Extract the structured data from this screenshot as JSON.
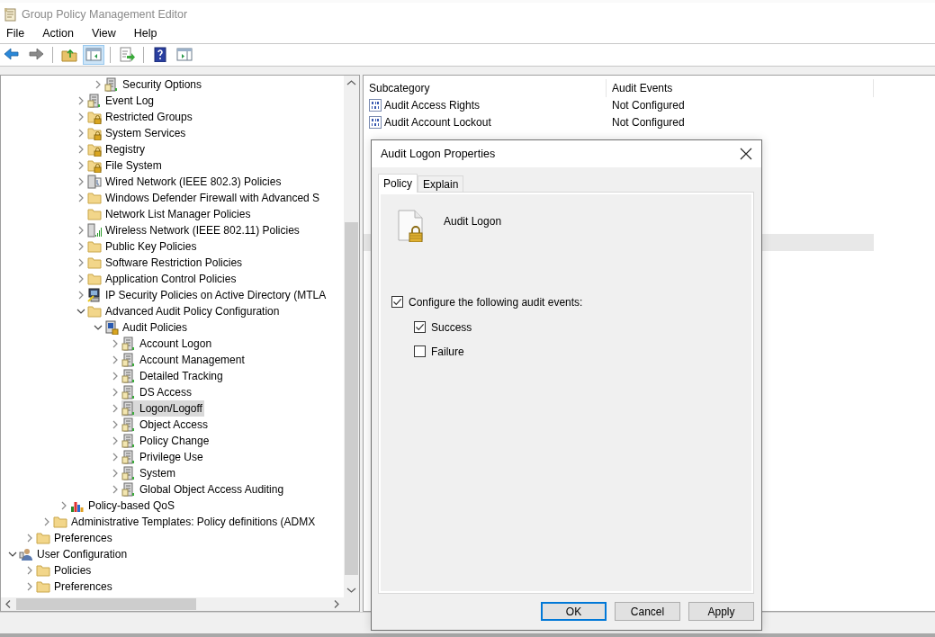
{
  "window": {
    "title": "Group Policy Management Editor"
  },
  "menu": [
    "File",
    "Action",
    "View",
    "Help"
  ],
  "toolbar": {
    "buttons": [
      {
        "pressed": false
      },
      {
        "pressed": false
      },
      {
        "pressed": false
      },
      {
        "pressed": true
      },
      {
        "pressed": false
      },
      {
        "pressed": false
      },
      {
        "pressed": false
      }
    ]
  },
  "tree": {
    "items": [
      {
        "children": [
          {
            "children": [
              {
                "children": [
                  {
                    "children": [
                      {
                        "children": [
                          {
                            "label": "Security Options",
                            "kind": "policy",
                            "expanded": false,
                            "selected": false
                          }
                        ]
                      },
                      {
                        "label": "Event Log",
                        "kind": "policy",
                        "expanded": false,
                        "selected": false
                      },
                      {
                        "label": "Restricted Groups",
                        "kind": "lockfolder",
                        "expanded": false,
                        "selected": false
                      },
                      {
                        "label": "System Services",
                        "kind": "lockfolder",
                        "expanded": false,
                        "selected": false
                      },
                      {
                        "label": "Registry",
                        "kind": "lockfolder",
                        "expanded": false,
                        "selected": false
                      },
                      {
                        "label": "File System",
                        "kind": "lockfolder",
                        "expanded": false,
                        "selected": false
                      },
                      {
                        "label": "Wired Network (IEEE 802.3) Policies",
                        "kind": "wired",
                        "expanded": false,
                        "selected": false
                      },
                      {
                        "label": "Windows Defender Firewall with Advanced S",
                        "kind": "folder",
                        "expanded": false,
                        "selected": false
                      },
                      {
                        "label": "Network List Manager Policies",
                        "kind": "folder",
                        "selected": false
                      },
                      {
                        "label": "Wireless Network (IEEE 802.11) Policies",
                        "kind": "wireless",
                        "expanded": false,
                        "selected": false
                      },
                      {
                        "label": "Public Key Policies",
                        "kind": "folder",
                        "expanded": false,
                        "selected": false
                      },
                      {
                        "label": "Software Restriction Policies",
                        "kind": "folder",
                        "expanded": false,
                        "selected": false
                      },
                      {
                        "label": "Application Control Policies",
                        "kind": "folder",
                        "expanded": false,
                        "selected": false
                      },
                      {
                        "label": "IP Security Policies on Active Directory (MTLA",
                        "kind": "ipsec",
                        "expanded": false,
                        "selected": false
                      },
                      {
                        "label": "Advanced Audit Policy Configuration",
                        "kind": "folder",
                        "expanded": true,
                        "selected": false,
                        "children": [
                          {
                            "label": "Audit Policies",
                            "kind": "audit",
                            "expanded": true,
                            "selected": false,
                            "children": [
                              {
                                "label": "Account Logon",
                                "kind": "policy",
                                "expanded": false,
                                "selected": false
                              },
                              {
                                "label": "Account Management",
                                "kind": "policy",
                                "expanded": false,
                                "selected": false
                              },
                              {
                                "label": "Detailed Tracking",
                                "kind": "policy",
                                "expanded": false,
                                "selected": false
                              },
                              {
                                "label": "DS Access",
                                "kind": "policy",
                                "expanded": false,
                                "selected": false
                              },
                              {
                                "label": "Logon/Logoff",
                                "kind": "policy",
                                "expanded": false,
                                "selected": true
                              },
                              {
                                "label": "Object Access",
                                "kind": "policy",
                                "expanded": false,
                                "selected": false
                              },
                              {
                                "label": "Policy Change",
                                "kind": "policy",
                                "expanded": false,
                                "selected": false
                              },
                              {
                                "label": "Privilege Use",
                                "kind": "policy",
                                "expanded": false,
                                "selected": false
                              },
                              {
                                "label": "System",
                                "kind": "policy",
                                "expanded": false,
                                "selected": false
                              },
                              {
                                "label": "Global Object Access Auditing",
                                "kind": "policy",
                                "expanded": false,
                                "selected": false
                              }
                            ]
                          }
                        ]
                      }
                    ]
                  },
                  {
                    "label": "Policy-based QoS",
                    "kind": "qos",
                    "expanded": false,
                    "selected": false
                  }
                ]
              },
              {
                "label": "Administrative Templates: Policy definitions (ADMX",
                "kind": "folder",
                "expanded": false,
                "selected": false
              }
            ]
          },
          {
            "label": "Preferences",
            "kind": "folder",
            "expanded": false,
            "selected": false
          }
        ]
      },
      {
        "label": "User Configuration",
        "kind": "user",
        "expanded": true,
        "selected": false,
        "children": [
          {
            "label": "Policies",
            "kind": "folder",
            "expanded": false,
            "selected": false
          },
          {
            "label": "Preferences",
            "kind": "folder",
            "expanded": false,
            "selected": false
          }
        ]
      }
    ]
  },
  "list": {
    "columns": [
      "Subcategory",
      "Audit Events"
    ],
    "rows": [
      {
        "subcategory": "Audit Access Rights",
        "audit_events": "Not Configured"
      },
      {
        "subcategory": "Audit Account Lockout",
        "audit_events": "Not Configured"
      }
    ],
    "selection_band": true
  },
  "dialog": {
    "title": "Audit Logon Properties",
    "tabs": [
      {
        "label": "Policy",
        "selected": true
      },
      {
        "label": "Explain",
        "selected": false
      }
    ],
    "policy_name": "Audit Logon",
    "configure": {
      "label": "Configure the following audit events:",
      "checked": true
    },
    "options": [
      {
        "label": "Success",
        "checked": true
      },
      {
        "label": "Failure",
        "checked": false
      }
    ],
    "buttons": [
      {
        "label": "OK",
        "default": true
      },
      {
        "label": "Cancel",
        "default": false
      },
      {
        "label": "Apply",
        "default": false
      }
    ]
  }
}
